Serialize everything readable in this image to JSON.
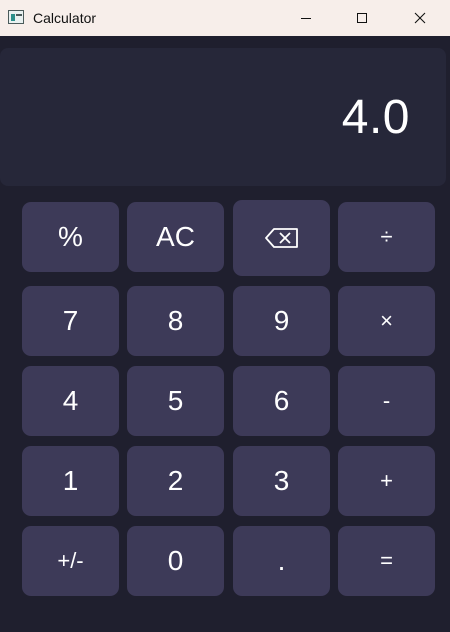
{
  "window": {
    "title": "Calculator"
  },
  "display": {
    "value": "4.0"
  },
  "keys": {
    "percent": "%",
    "clear": "AC",
    "backspace_icon": "backspace-icon",
    "divide": "÷",
    "seven": "7",
    "eight": "8",
    "nine": "9",
    "multiply": "×",
    "four": "4",
    "five": "5",
    "six": "6",
    "minus": "-",
    "one": "1",
    "two": "2",
    "three": "3",
    "plus": "+",
    "sign": "+/-",
    "zero": "0",
    "decimal": ".",
    "equals": "="
  },
  "colors": {
    "background": "#1f1f2e",
    "display_background": "#262739",
    "key_background": "#3d3a58",
    "titlebar_background": "#f7eeea",
    "text": "#ffffff"
  }
}
